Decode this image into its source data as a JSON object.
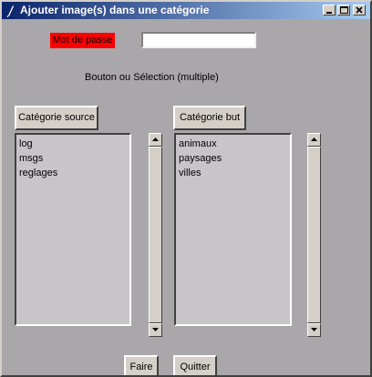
{
  "window": {
    "title": "Ajouter image(s) dans une catégorie"
  },
  "form": {
    "password_label": "Mot de passe",
    "password_value": "",
    "hint": "Bouton ou Sélection (multiple)"
  },
  "source": {
    "button_label": "Catégorie source",
    "items": [
      "log",
      "msgs",
      "reglages"
    ]
  },
  "target": {
    "button_label": "Catégorie but",
    "items": [
      "animaux",
      "paysages",
      "villes"
    ]
  },
  "actions": {
    "faire_label": "Faire",
    "quitter_label": "Quitter"
  },
  "colors": {
    "password_label_bg": "#ff0000",
    "titlebar_start": "#0a246a",
    "titlebar_end": "#a6caf0"
  },
  "icons": {
    "window": "feather-icon",
    "minimize": "minimize-icon",
    "maximize": "maximize-icon",
    "close": "close-icon",
    "scroll_up": "arrow-up-icon",
    "scroll_down": "arrow-down-icon"
  }
}
